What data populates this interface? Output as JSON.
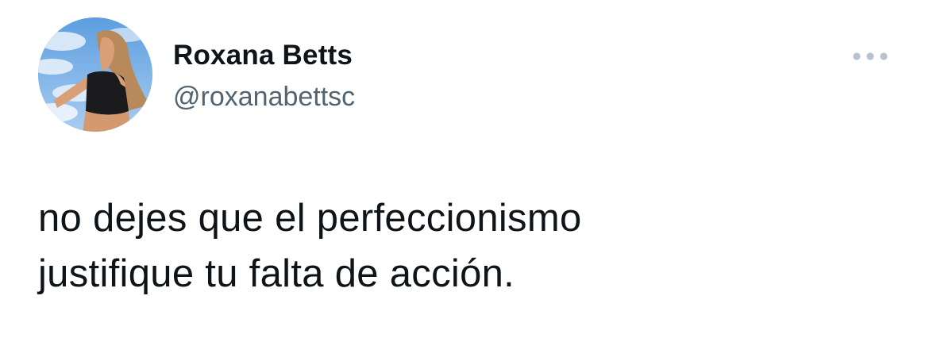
{
  "tweet": {
    "author": {
      "display_name": "Roxana Betts",
      "handle": "@roxanabettsc",
      "avatar_icon": "profile-photo"
    },
    "more_icon": "more-options-icon",
    "text_lines": [
      "no dejes que el perfeccionismo",
      "justifique tu falta de acción."
    ]
  },
  "colors": {
    "text_primary": "#0f1419",
    "text_secondary": "#536471",
    "icon_gray": "#b9c3cc",
    "background": "#ffffff"
  }
}
